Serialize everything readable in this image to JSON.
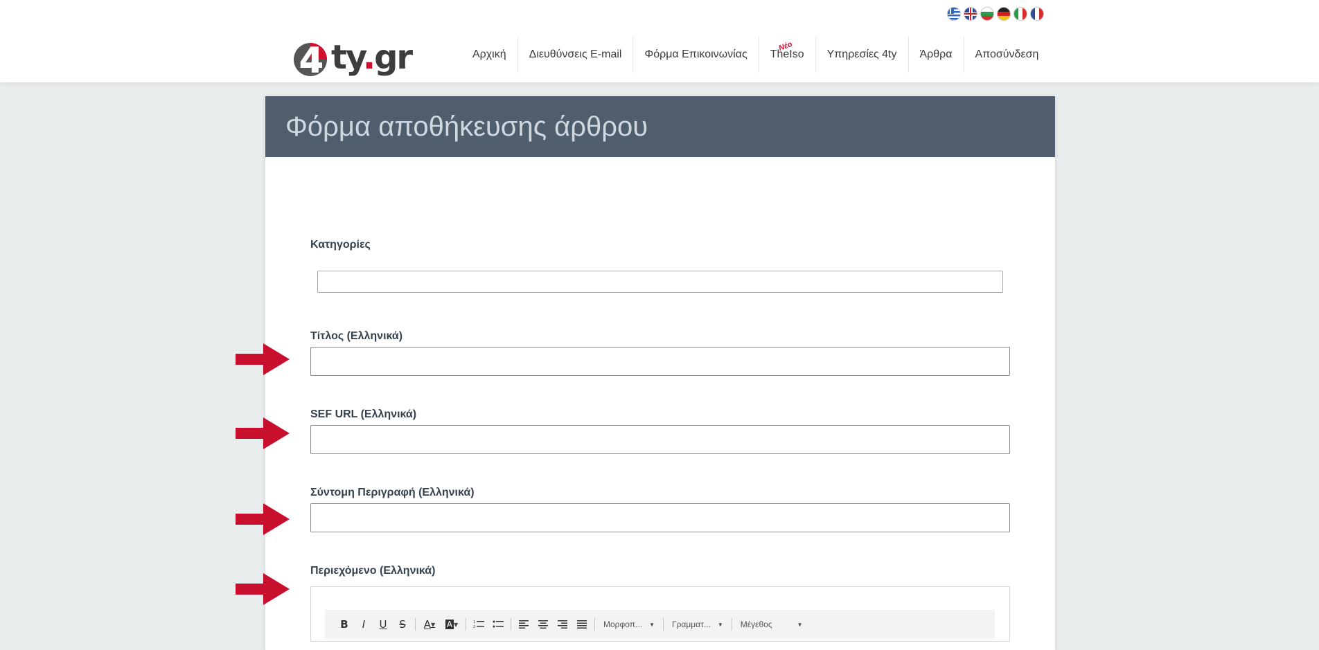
{
  "languages": [
    "greek-flag",
    "english-flag",
    "bulgarian-flag",
    "german-flag",
    "italian-flag",
    "french-flag"
  ],
  "logo": {
    "text": "4ty.gr",
    "brand_color": "#d0102f"
  },
  "nav": [
    {
      "label": "Αρχική"
    },
    {
      "label": "Διευθύνσεις E-mail"
    },
    {
      "label": "Φόρμα Επικοινωνίας"
    },
    {
      "label": "TheIso",
      "badge": "Νέο"
    },
    {
      "label": "Υπηρεσίες 4ty"
    },
    {
      "label": "Άρθρα"
    },
    {
      "label": "Αποσύνδεση"
    }
  ],
  "form": {
    "title": "Φόρμα αποθήκευσης άρθρου",
    "header_color": "#505d6d",
    "categories_label": "Κατηγορίες",
    "categories_value": "",
    "title_label": "Τίτλος (Ελληνικά)",
    "title_value": "",
    "sef_label": "SEF URL (Ελληνικά)",
    "sef_value": "",
    "short_desc_label": "Σύντομη Περιγραφή (Ελληνικά)",
    "short_desc_value": "",
    "content_label": "Περιεχόμενο (Ελληνικά)"
  },
  "editor_toolbar": {
    "bold": "B",
    "italic": "I",
    "underline": "U",
    "strike": "S",
    "text_color": "A",
    "bg_color": "A",
    "format_select": "Μορφοπ...",
    "font_select": "Γραμματ...",
    "size_select": "Μέγεθος"
  },
  "annotation_color": "#c8102e"
}
